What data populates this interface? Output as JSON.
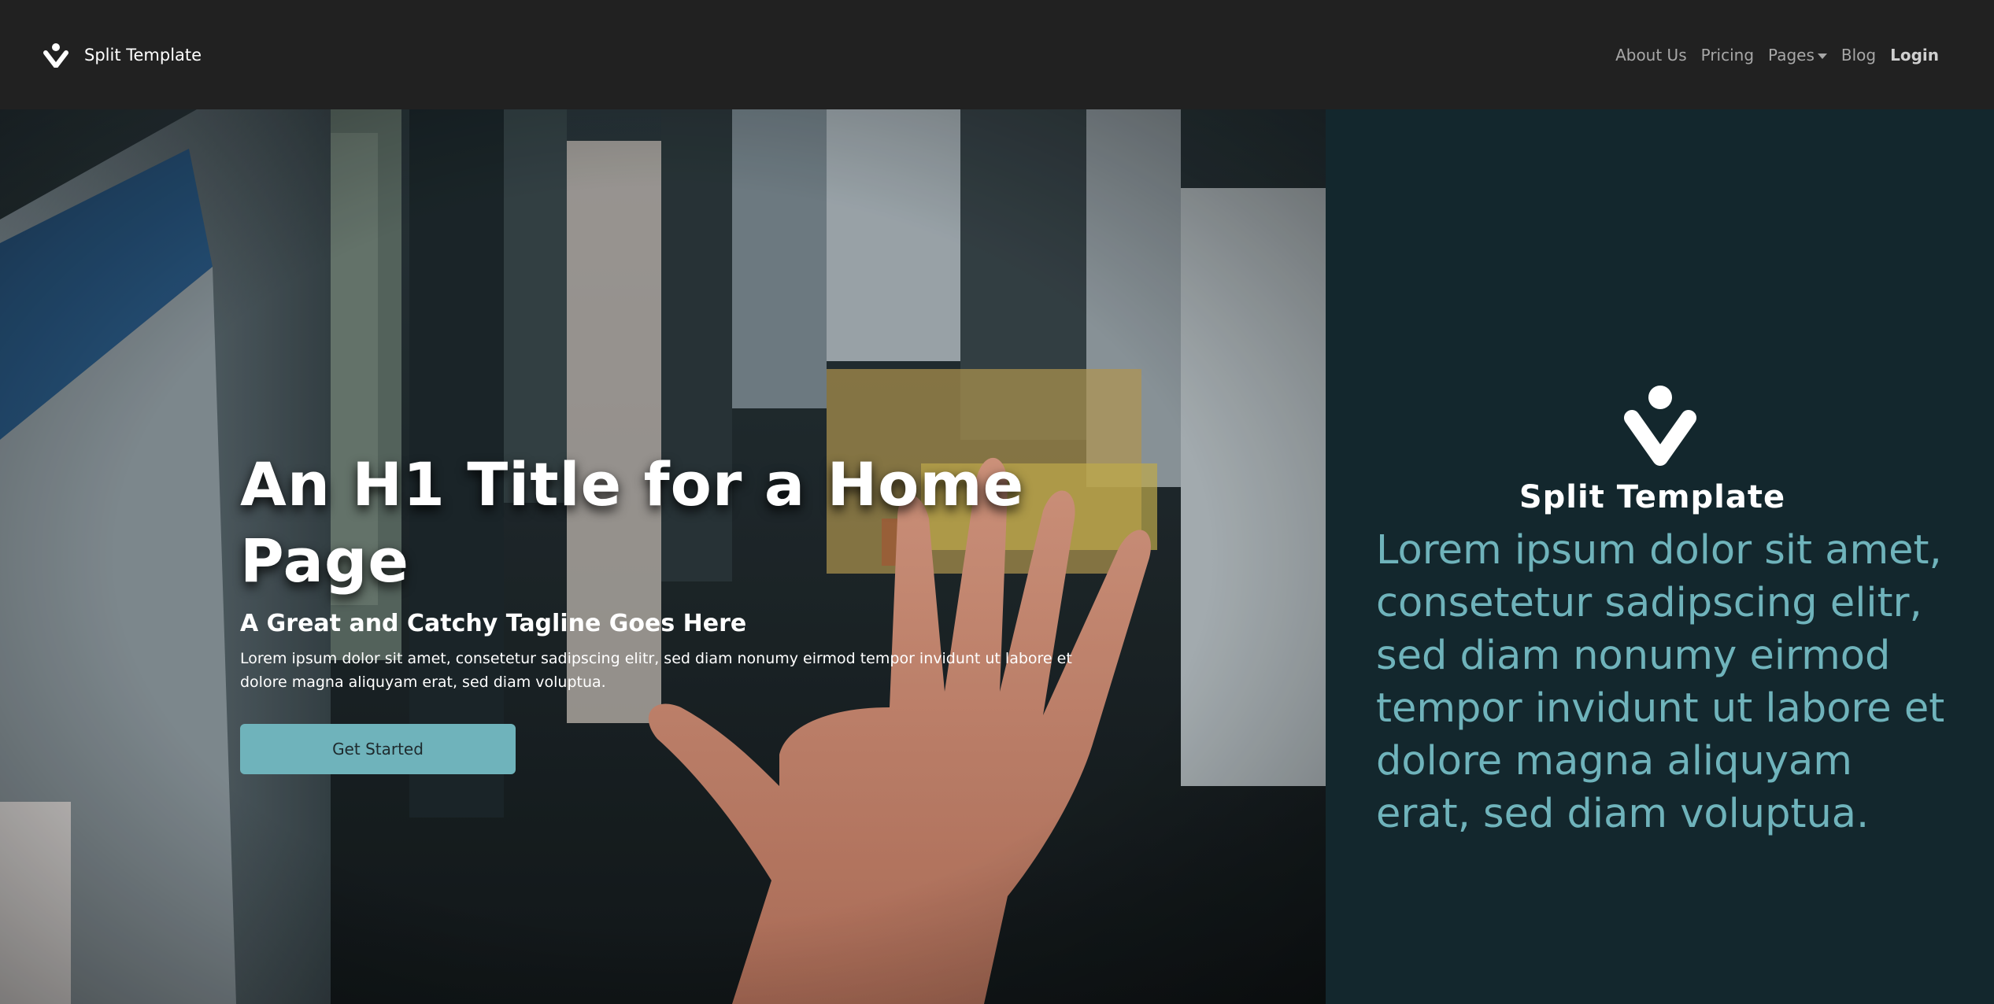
{
  "navbar": {
    "brand_name": "Split Template",
    "brand_icon": "v-person-icon",
    "links": {
      "about": "About Us",
      "pricing": "Pricing",
      "pages": "Pages",
      "blog": "Blog",
      "login": "Login"
    }
  },
  "hero": {
    "title": "An H1 Title for a Home Page",
    "tagline": "A Great and Catchy Tagline Goes Here",
    "text": "Lorem ipsum dolor sit amet, consetetur sadipscing elitr, sed diam nonumy eirmod tempor invidunt ut labore et dolore magna aliquyam erat, sed diam voluptua.",
    "cta_label": "Get Started"
  },
  "panel": {
    "brand_name": "Split Template",
    "text": "Lorem ipsum dolor sit amet, consetetur sadipscing elitr, sed diam nonumy eirmod tempor invidunt ut labore et dolore magna aliquyam erat, sed diam voluptua."
  },
  "colors": {
    "navbar_bg": "#212121",
    "panel_bg": "#13272d",
    "accent": "#6fb3bb",
    "nav_link": "#a7a7a7"
  }
}
